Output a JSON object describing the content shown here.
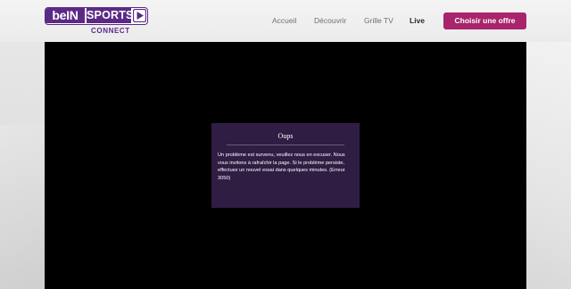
{
  "brand": {
    "bein": "beIN",
    "sports": "SPORTS",
    "connect": "CONNECT",
    "color": "#5b2a86"
  },
  "nav": {
    "items": [
      {
        "label": "Accueil",
        "active": false
      },
      {
        "label": "Découvrir",
        "active": false
      },
      {
        "label": "Grille TV",
        "active": false
      },
      {
        "label": "Live",
        "active": true
      }
    ],
    "cta_label": "Choisir une offre",
    "cta_color": "#a8246c"
  },
  "player": {
    "error": {
      "title": "Oups",
      "message": "Un problème est survenu, veuillez nous en excuser. Nous vous invitons à rafraîchir la page. Si le problème persiste, effectuez un nouvel essai dans quelques minutes. (Erreur 3050)",
      "background": "#301d44"
    }
  }
}
